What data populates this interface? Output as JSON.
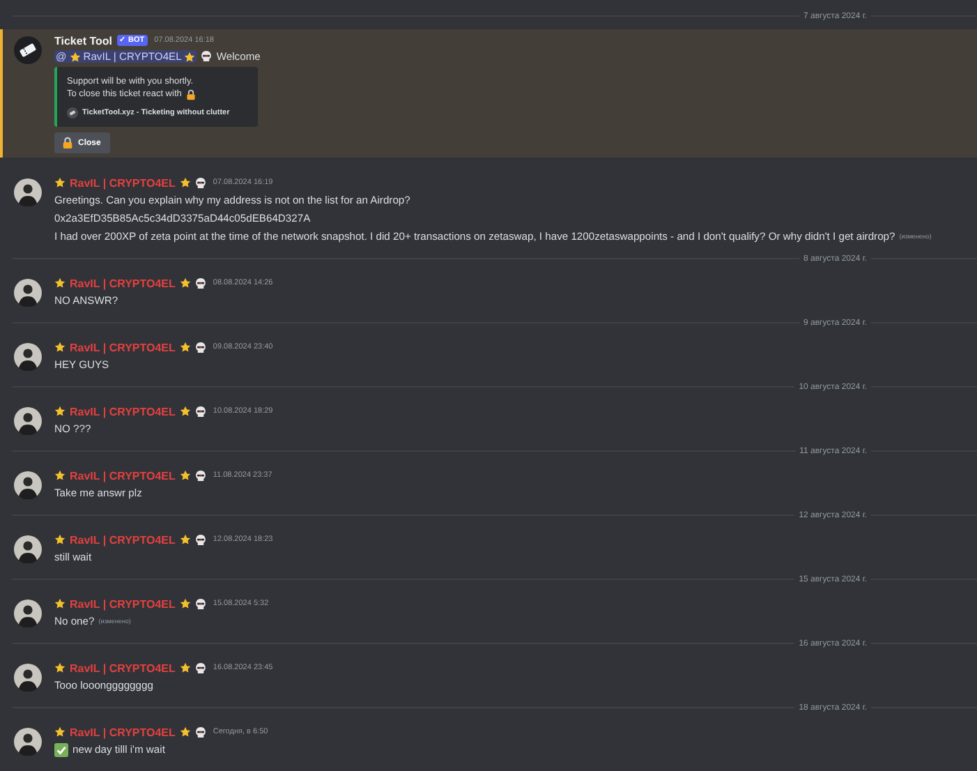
{
  "feed": [
    {
      "kind": "divider",
      "label": "7 августа 2024 г."
    },
    {
      "kind": "bot",
      "author": "Ticket Tool",
      "badge": "✓ BOT",
      "time": "07.08.2024 16:18",
      "mention": "@",
      "mention_name": "RavIL | CRYPTO4EL",
      "text": "Welcome",
      "embed": {
        "lines": [
          "Support will be with you shortly.",
          "To close this ticket react with"
        ],
        "footer": "TicketTool.xyz - Ticketing without clutter"
      },
      "button": "Close"
    },
    {
      "kind": "user",
      "author": "RavIL | CRYPTO4EL",
      "time": "07.08.2024 16:19",
      "lines": [
        {
          "kind": "plain",
          "text": "Greetings. Can you explain why my address is not on the list for an Airdrop?"
        },
        {
          "kind": "plain",
          "text": "0x2a3EfD35B85Ac5c34dD3375aD44c05dEB64D327A"
        },
        {
          "kind": "plain",
          "text": "I had over 200XP of zeta point  at the time of the network snapshot. I did 20+ transactions on zetaswap, I have 1200zetaswappoints - and I don't qualify? Or why didn't I get airdrop?",
          "edited": "(изменено)"
        }
      ]
    },
    {
      "kind": "divider",
      "label": "8 августа 2024 г."
    },
    {
      "kind": "user",
      "author": "RavIL | CRYPTO4EL",
      "time": "08.08.2024 14:26",
      "lines": [
        {
          "kind": "plain",
          "text": "NO ANSWR?"
        }
      ]
    },
    {
      "kind": "divider",
      "label": "9 августа 2024 г."
    },
    {
      "kind": "user",
      "author": "RavIL | CRYPTO4EL",
      "time": "09.08.2024 23:40",
      "lines": [
        {
          "kind": "plain",
          "text": "HEY GUYS"
        }
      ]
    },
    {
      "kind": "divider",
      "label": "10 августа 2024 г."
    },
    {
      "kind": "user",
      "author": "RavIL | CRYPTO4EL",
      "time": "10.08.2024 18:29",
      "lines": [
        {
          "kind": "plain",
          "text": "NO ???"
        }
      ]
    },
    {
      "kind": "divider",
      "label": "11 августа 2024 г."
    },
    {
      "kind": "user",
      "author": "RavIL | CRYPTO4EL",
      "time": "11.08.2024 23:37",
      "lines": [
        {
          "kind": "plain",
          "text": "Take me answr plz"
        }
      ]
    },
    {
      "kind": "divider",
      "label": "12 августа 2024 г."
    },
    {
      "kind": "user",
      "author": "RavIL | CRYPTO4EL",
      "time": "12.08.2024 18:23",
      "lines": [
        {
          "kind": "plain",
          "text": "still wait"
        }
      ]
    },
    {
      "kind": "divider",
      "label": "15 августа 2024 г."
    },
    {
      "kind": "user",
      "author": "RavIL | CRYPTO4EL",
      "time": "15.08.2024 5:32",
      "lines": [
        {
          "kind": "plain",
          "text": "No one?",
          "edited": "(изменено)"
        }
      ]
    },
    {
      "kind": "divider",
      "label": "16 августа 2024 г."
    },
    {
      "kind": "user",
      "author": "RavIL | CRYPTO4EL",
      "time": "16.08.2024 23:45",
      "lines": [
        {
          "kind": "plain",
          "text": "Tooo looongggggggg"
        }
      ]
    },
    {
      "kind": "divider",
      "label": "18 августа 2024 г."
    },
    {
      "kind": "user",
      "author": "RavIL | CRYPTO4EL",
      "time": "Сегодня, в 6:50",
      "lines": [
        {
          "kind": "check",
          "text": "new day tilll i'm wait"
        }
      ]
    }
  ]
}
